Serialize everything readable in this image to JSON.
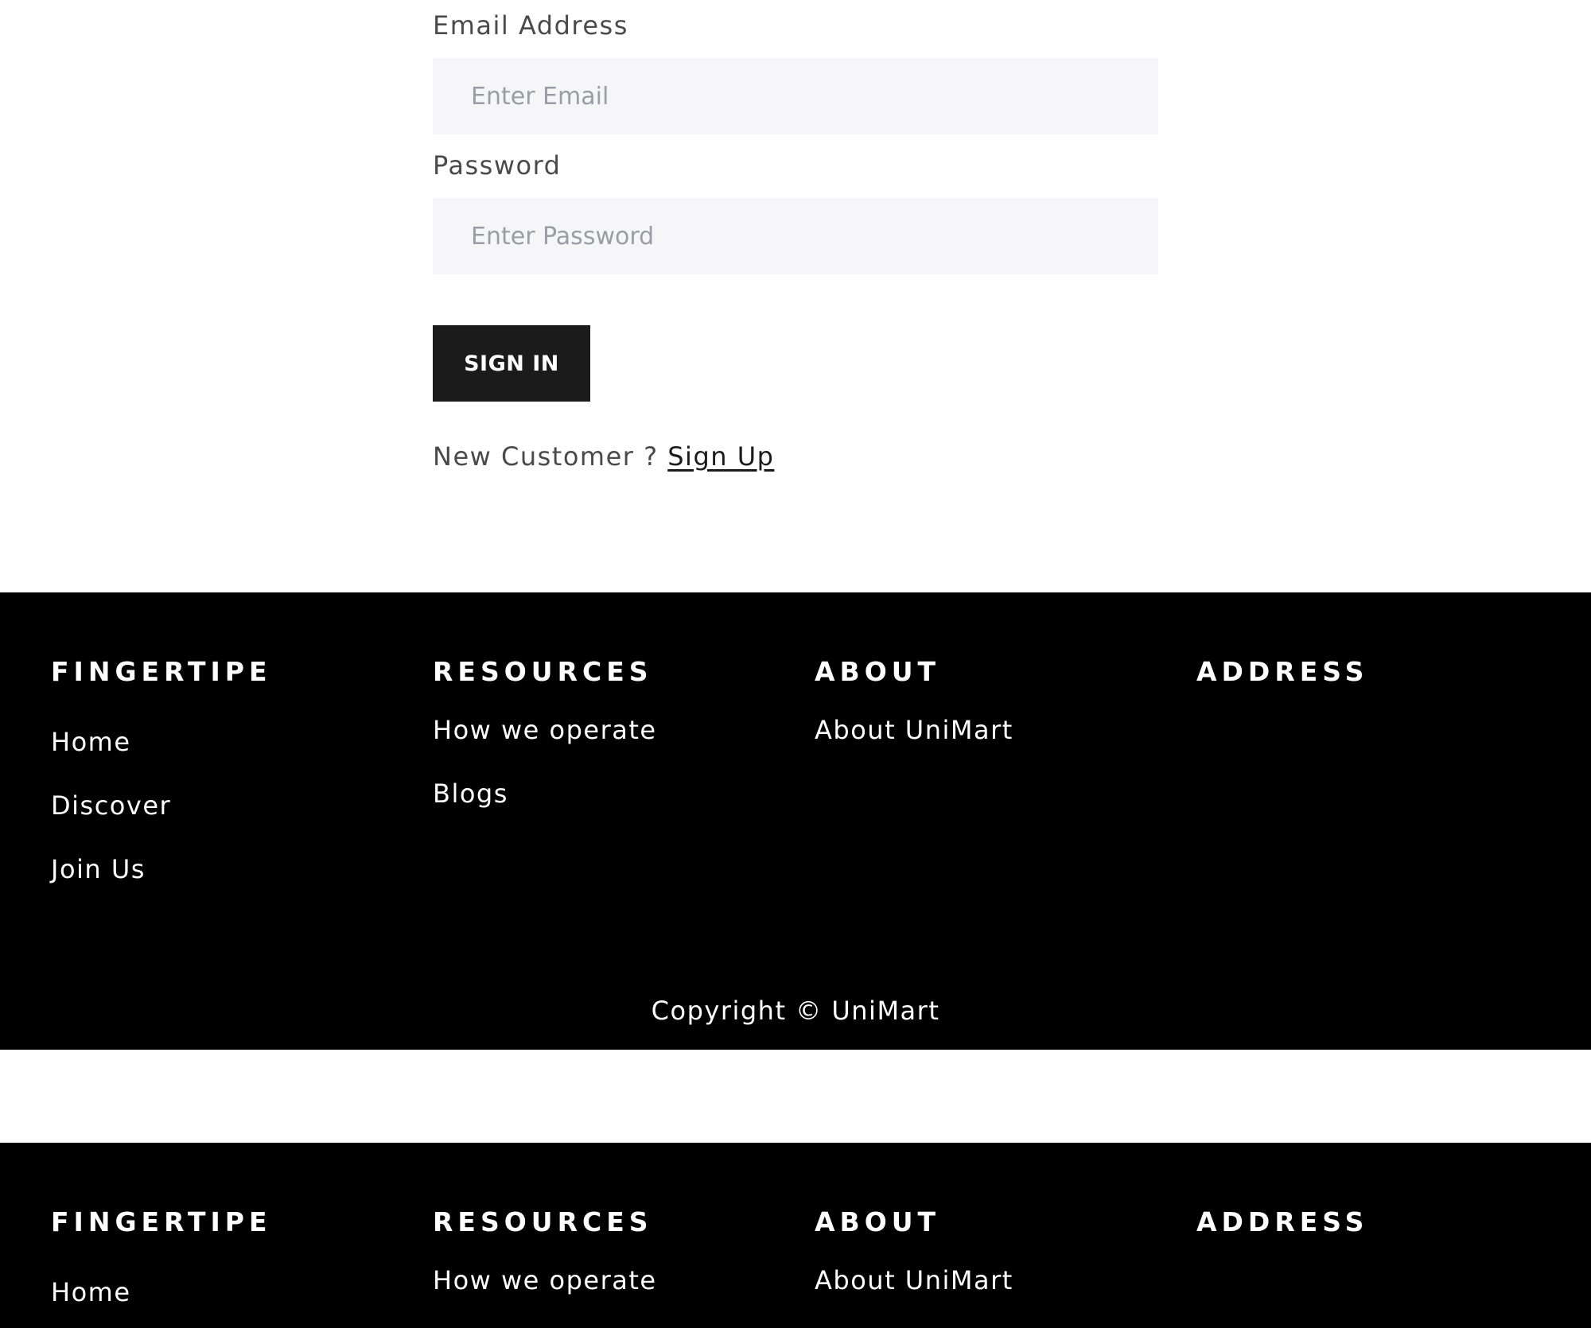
{
  "signin_form": {
    "email_label": "Email Address",
    "email_placeholder": "Enter Email",
    "password_label": "Password",
    "password_placeholder": "Enter Password",
    "signin_button": "SIGN IN",
    "new_customer_text": "New Customer ?",
    "signup_link": "Sign Up"
  },
  "footer": {
    "columns": [
      {
        "heading": "FINGERTIPE",
        "links": [
          "Home",
          "Discover",
          "Join Us"
        ]
      },
      {
        "heading": "RESOURCES",
        "links": [
          "How we operate",
          "Blogs"
        ]
      },
      {
        "heading": "ABOUT",
        "links": [
          "About UniMart"
        ]
      },
      {
        "heading": "ADDRESS",
        "links": []
      }
    ],
    "copyright": "Copyright © UniMart"
  },
  "colors": {
    "button_bg": "#1b1b1c",
    "input_bg": "#f6f6f8",
    "footer_bg": "#000000",
    "label_text": "#4a4a4a",
    "placeholder_text": "#9a9da2"
  }
}
